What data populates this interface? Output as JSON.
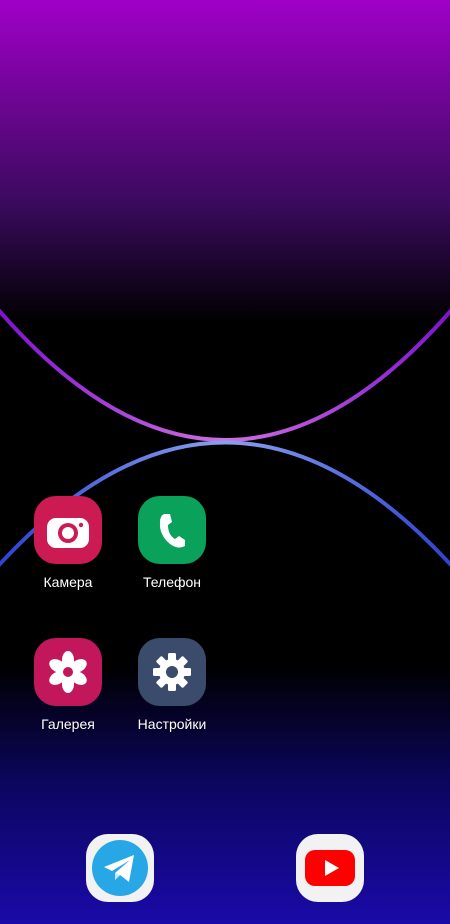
{
  "wallpaper": {
    "top_color": "#a000c8",
    "mid_color": "#000000",
    "bottom_color": "#1a0aa8",
    "upper_arc_color": "#c46de8",
    "lower_arc_color": "#5a78e0"
  },
  "apps": [
    {
      "label": "Камера",
      "icon": "camera-icon",
      "color": "#cc1a53"
    },
    {
      "label": "Телефон",
      "icon": "phone-icon",
      "color": "#0aa15a"
    },
    {
      "label": "Галерея",
      "icon": "flower-icon",
      "color": "#c2185b"
    },
    {
      "label": "Настройки",
      "icon": "gear-icon",
      "color": "#3b4b6b"
    }
  ],
  "dock": [
    {
      "icon": "telegram-icon",
      "color": "#27a7e5"
    },
    {
      "icon": "youtube-icon",
      "color": "#ff0000"
    }
  ]
}
